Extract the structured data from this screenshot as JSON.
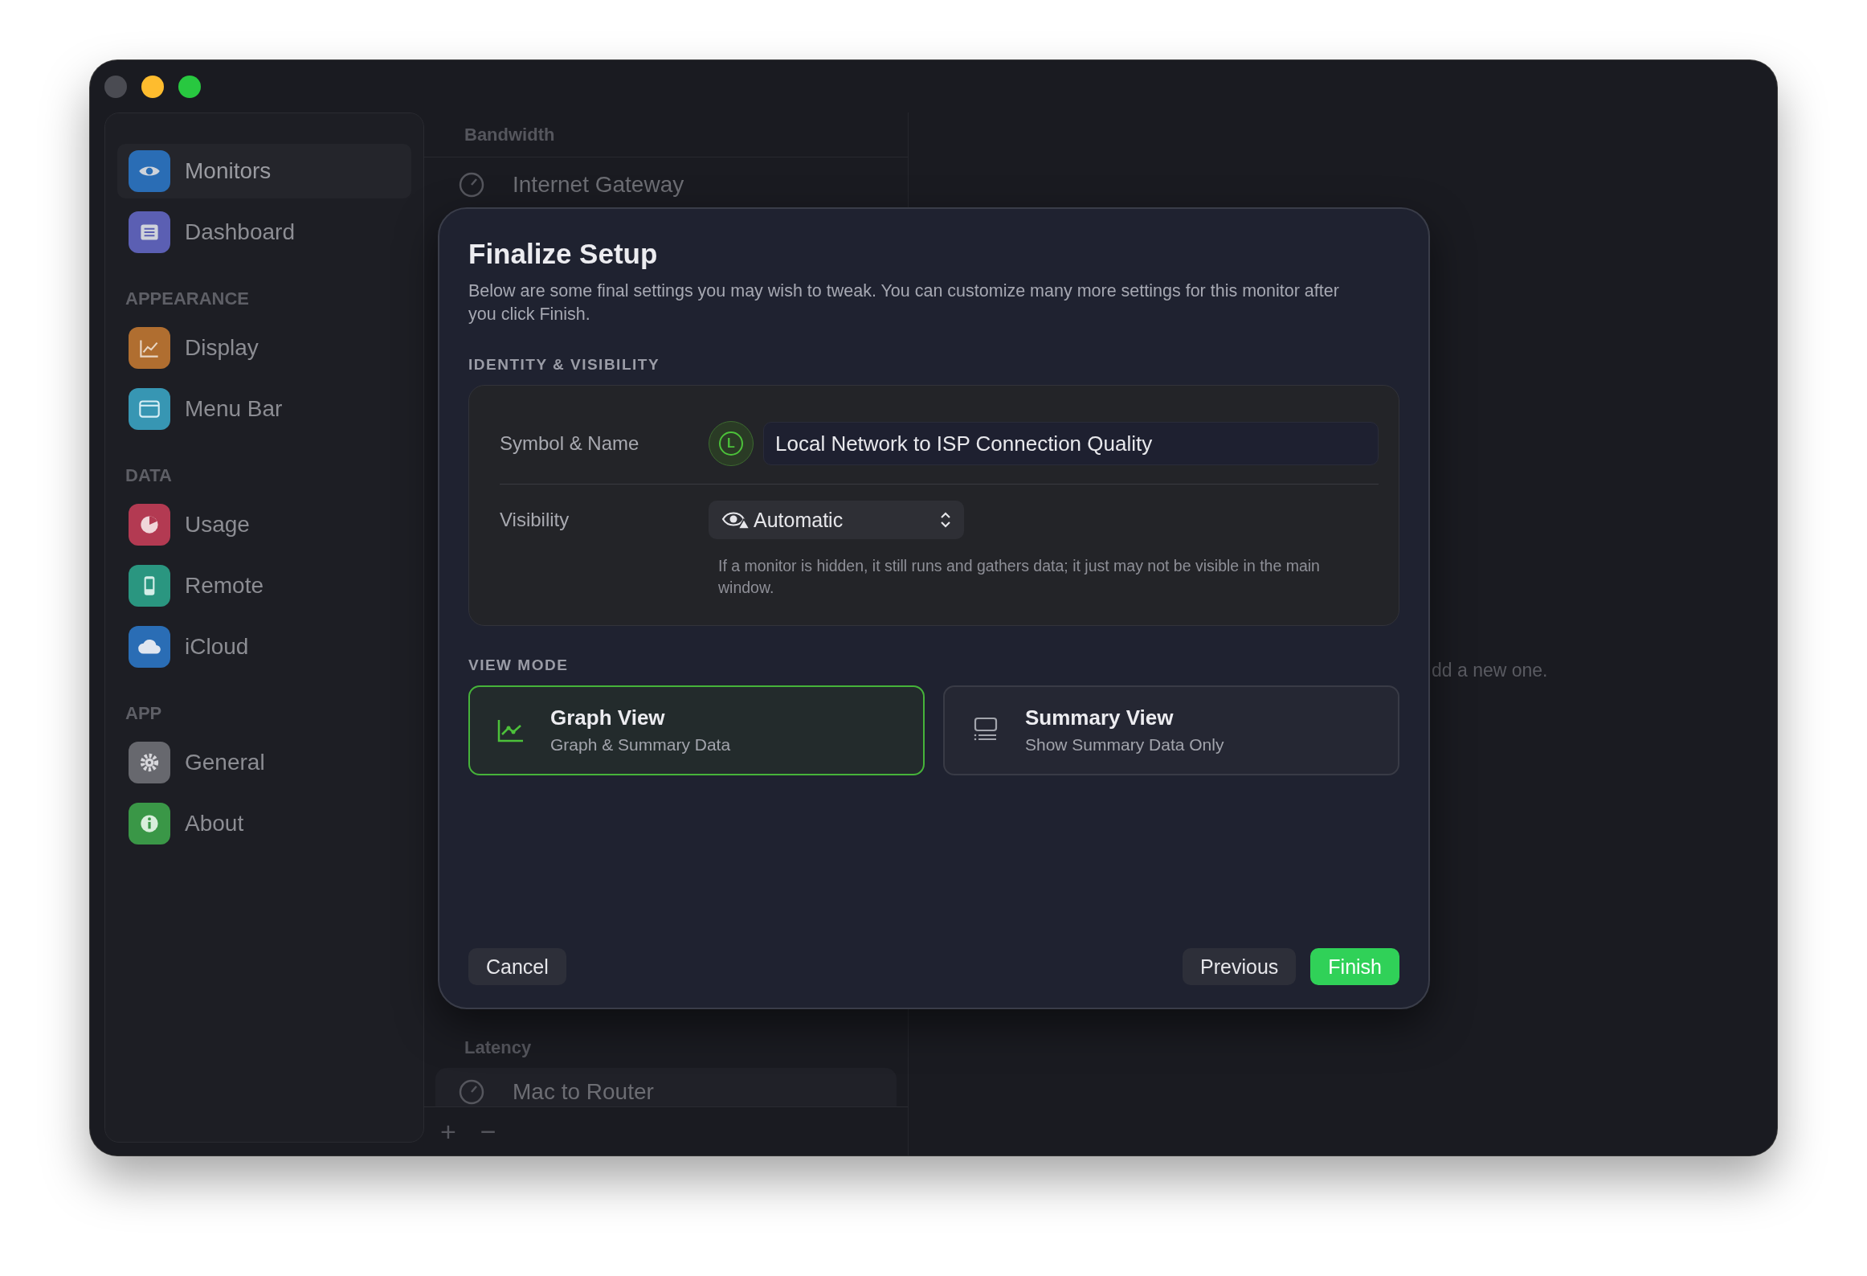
{
  "sidebar": {
    "sections": [
      {
        "items": [
          {
            "label": "Monitors",
            "selected": true,
            "color": "#2a6db5"
          },
          {
            "label": "Dashboard",
            "selected": false,
            "color": "#5b5fb3"
          }
        ]
      },
      {
        "title": "APPEARANCE",
        "items": [
          {
            "label": "Display",
            "selected": false,
            "color": "#b06e30"
          },
          {
            "label": "Menu Bar",
            "selected": false,
            "color": "#3796b3"
          }
        ]
      },
      {
        "title": "DATA",
        "items": [
          {
            "label": "Usage",
            "selected": false,
            "color": "#b33a52"
          },
          {
            "label": "Remote",
            "selected": false,
            "color": "#2a9680"
          },
          {
            "label": "iCloud",
            "selected": false,
            "color": "#2a6db5"
          }
        ]
      },
      {
        "title": "APP",
        "items": [
          {
            "label": "General",
            "selected": false,
            "color": "#67686e"
          },
          {
            "label": "About",
            "selected": false,
            "color": "#3a9747"
          }
        ]
      }
    ]
  },
  "monitor_list": {
    "groups": [
      {
        "title": "Bandwidth",
        "rows": [
          {
            "name": "Internet Gateway"
          }
        ]
      },
      {
        "title": "Latency",
        "rows": [
          {
            "name": "Mac to Router"
          }
        ]
      }
    ],
    "toolbar": {
      "add": "+",
      "remove": "−"
    }
  },
  "detail": {
    "hint": "dd a new one."
  },
  "sheet": {
    "title": "Finalize Setup",
    "description": "Below are some final settings you may wish to tweak. You can customize many more settings for this monitor after you click Finish.",
    "identity": {
      "header": "IDENTITY & VISIBILITY",
      "symbol_label": "Symbol & Name",
      "symbol": "L",
      "name": "Local Network to ISP Connection Quality",
      "visibility_label": "Visibility",
      "visibility": "Automatic",
      "visibility_hint": "If a monitor is hidden, it still runs and gathers data; it just may not be visible in the main window."
    },
    "view_mode": {
      "header": "VIEW MODE",
      "options": [
        {
          "title": "Graph View",
          "subtitle": "Graph & Summary Data",
          "selected": true
        },
        {
          "title": "Summary View",
          "subtitle": "Show Summary Data Only",
          "selected": false
        }
      ]
    },
    "left_buttons": [
      {
        "label": "Cancel"
      }
    ],
    "right_buttons": [
      {
        "label": "Previous",
        "kind": "secondary"
      },
      {
        "label": "Finish",
        "kind": "primary"
      }
    ]
  }
}
